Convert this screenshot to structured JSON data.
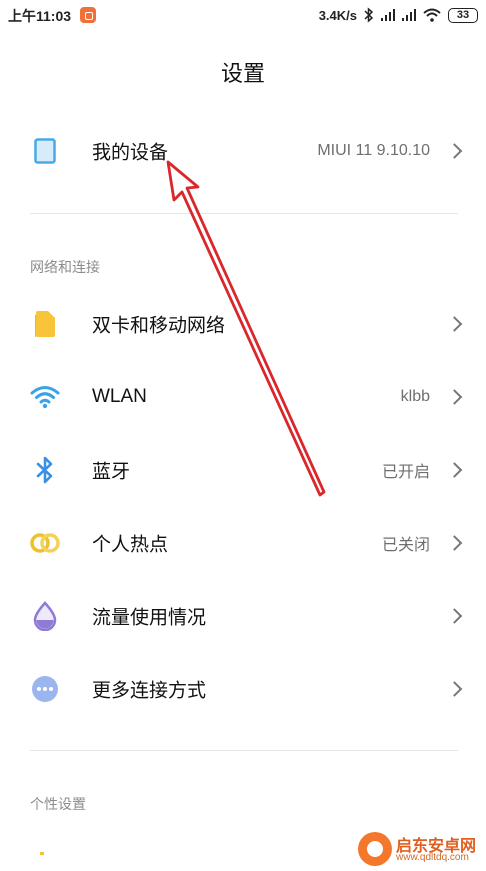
{
  "status_bar": {
    "time": "上午11:03",
    "net_speed": "3.4K/s",
    "battery": "33",
    "icons": [
      "app-icon",
      "bluetooth-icon",
      "signal-icon",
      "signal-icon",
      "wifi-icon",
      "battery-icon"
    ]
  },
  "page": {
    "title": "设置"
  },
  "device_row": {
    "label": "我的设备",
    "value": "MIUI 11 9.10.10",
    "icon": "phone-icon",
    "icon_color": "#48a8e8"
  },
  "section_network": {
    "header": "网络和连接",
    "items": [
      {
        "label": "双卡和移动网络",
        "value": "",
        "icon": "sim-card-icon",
        "icon_color": "#f7c43a"
      },
      {
        "label": "WLAN",
        "value": "klbb",
        "icon": "wifi-icon",
        "icon_color": "#3aa2ea"
      },
      {
        "label": "蓝牙",
        "value": "已开启",
        "icon": "bluetooth-icon",
        "icon_color": "#3a90e5"
      },
      {
        "label": "个人热点",
        "value": "已关闭",
        "icon": "hotspot-icon",
        "icon_color": "#efc02e"
      },
      {
        "label": "流量使用情况",
        "value": "",
        "icon": "data-usage-icon",
        "icon_color": "#8f7ad6"
      },
      {
        "label": "更多连接方式",
        "value": "",
        "icon": "more-connections-icon",
        "icon_color": "#7e9ee8"
      }
    ]
  },
  "section_personal": {
    "header": "个性设置"
  },
  "annotation": {
    "color": "#d9272b"
  },
  "watermark": {
    "title": "启东安卓网",
    "url": "www.qdltdq.com",
    "logo_color": "#f5772b"
  }
}
